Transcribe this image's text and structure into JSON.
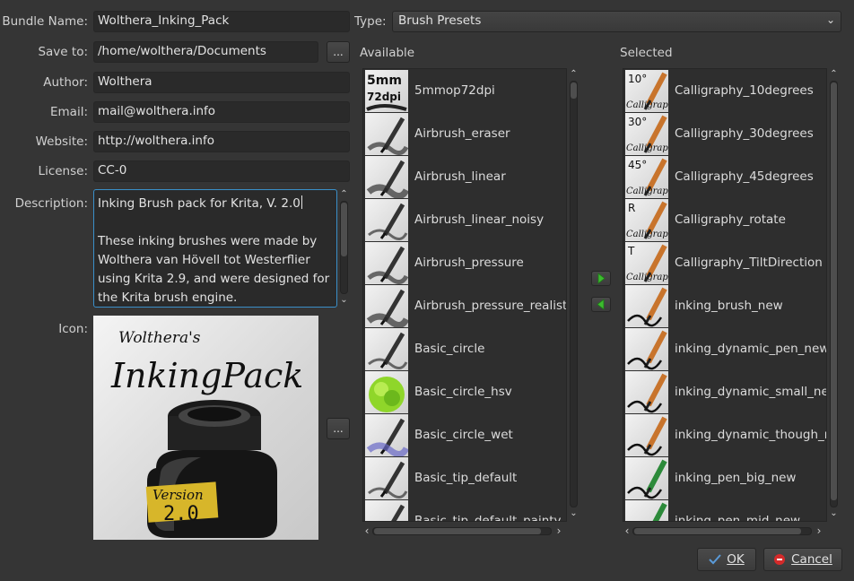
{
  "form": {
    "bundle_name_label": "Bundle Name:",
    "bundle_name": "Wolthera_Inking_Pack",
    "save_to_label": "Save to:",
    "save_to": "/home/wolthera/Documents",
    "browse_button": "...",
    "author_label": "Author:",
    "author": "Wolthera",
    "email_label": "Email:",
    "email": "mail@wolthera.info",
    "website_label": "Website:",
    "website": "http://wolthera.info",
    "license_label": "License:",
    "license": "CC-0",
    "description_label": "Description:",
    "description_line1": "Inking Brush pack for Krita, V. 2.0",
    "description_line2": "These inking brushes were made by",
    "description_line3": "Wolthera van Hövell tot Westerflier",
    "description_line4": "using Krita 2.9, and were designed for",
    "description_line5": "the Krita brush engine.",
    "icon_label": "Icon:",
    "icon_browse_button": "...",
    "icon_text_small": "Wolthera's",
    "icon_text_big": "InkingPack",
    "icon_version": "Version",
    "icon_version_num": "2.0"
  },
  "type": {
    "label": "Type:",
    "value": "Brush Presets"
  },
  "available": {
    "header": "Available",
    "items": [
      "5mmop72dpi",
      "Airbrush_eraser",
      "Airbrush_linear",
      "Airbrush_linear_noisy",
      "Airbrush_pressure",
      "Airbrush_pressure_realisti",
      "Basic_circle",
      "Basic_circle_hsv",
      "Basic_circle_wet",
      "Basic_tip_default",
      "Basic_tip_default_painty"
    ],
    "thumb_text": [
      "5mm 72dpi"
    ]
  },
  "selected": {
    "header": "Selected",
    "items": [
      "Calligraphy_10degrees",
      "Calligraphy_30degrees",
      "Calligraphy_45degrees",
      "Calligraphy_rotate",
      "Calligraphy_TiltDirection",
      "inking_brush_new",
      "inking_dynamic_pen_new",
      "inking_dynamic_small_new",
      "inking_dynamic_though_ne",
      "inking_pen_big_new",
      "inking_pen_mid_new"
    ],
    "thumb_text": [
      "10°",
      "30°",
      "45°",
      "R",
      "T"
    ],
    "thumb_caption": "Calligraphy"
  },
  "buttons": {
    "ok": "OK",
    "cancel": "Cancel"
  },
  "colors": {
    "background": "#353535",
    "field": "#2a2a2a",
    "focus_border": "#3a8fc8",
    "arrow_green": "#3dbb2f",
    "cancel_red": "#d42a2a",
    "ok_blue": "#5a9ad8"
  }
}
